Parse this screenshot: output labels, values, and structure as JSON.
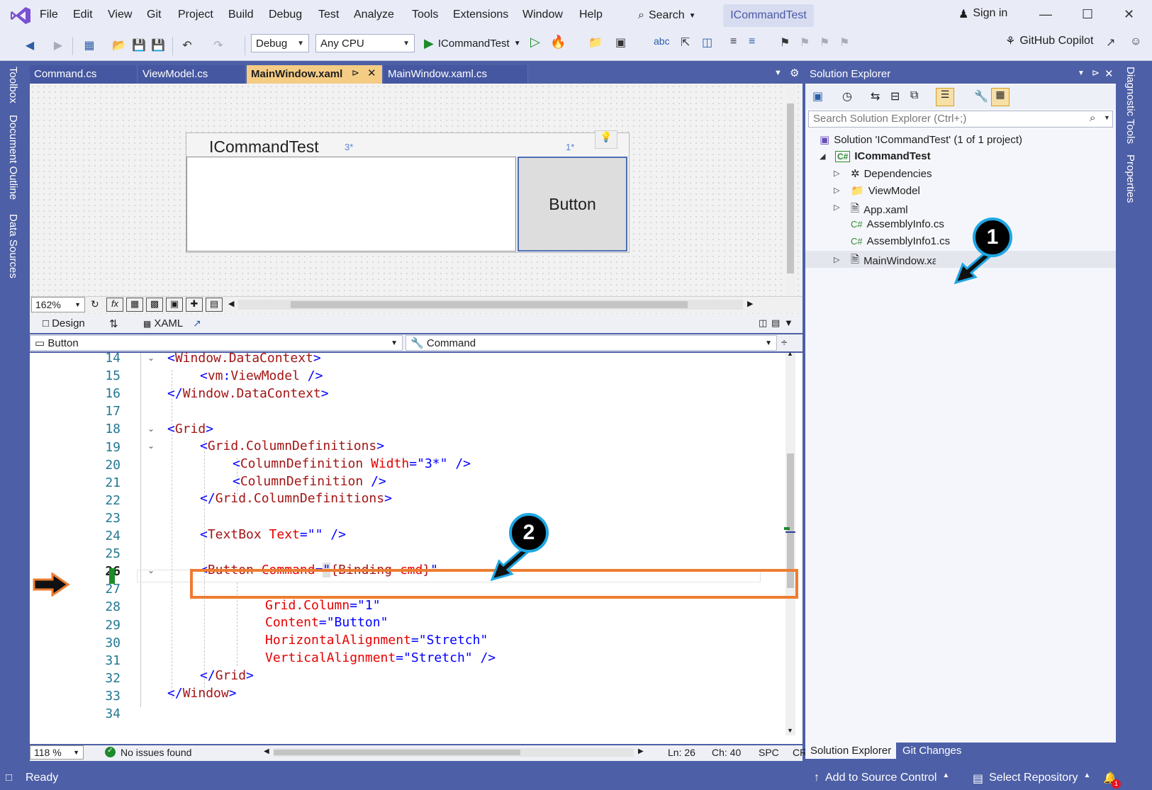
{
  "menubar": {
    "items": [
      "File",
      "Edit",
      "View",
      "Git",
      "Project",
      "Build",
      "Debug",
      "Test",
      "Analyze",
      "Tools",
      "Extensions",
      "Window",
      "Help"
    ],
    "search_label": "Search",
    "title": "ICommandTest",
    "sign_in": "Sign in"
  },
  "toolbar": {
    "config": "Debug",
    "platform": "Any CPU",
    "run_target": "ICommandTest",
    "copilot": "GitHub Copilot"
  },
  "left_rail": [
    "Toolbox",
    "Document Outline",
    "Data Sources"
  ],
  "right_rail": [
    "Diagnostic Tools",
    "Properties"
  ],
  "tabs": [
    {
      "label": "Command.cs"
    },
    {
      "label": "ViewModel.cs"
    },
    {
      "label": "MainWindow.xaml"
    },
    {
      "label": "MainWindow.xaml.cs"
    }
  ],
  "designer": {
    "window_title": "ICommandTest",
    "col1_marker": "3*",
    "col2_marker": "1*",
    "button_label": "Button",
    "zoom": "162%",
    "fx": "fx"
  },
  "split": {
    "design": "Design",
    "xaml": "XAML"
  },
  "nav": {
    "left": "Button",
    "right": "Command"
  },
  "code": {
    "line_numbers": [
      "14",
      "15",
      "16",
      "17",
      "18",
      "19",
      "20",
      "21",
      "22",
      "23",
      "24",
      "25",
      "26",
      "27",
      "28",
      "29",
      "30",
      "31",
      "32",
      "33",
      "34"
    ]
  },
  "editor_status": {
    "zoom": "118 %",
    "issues": "No issues found",
    "ln": "Ln: 26",
    "ch": "Ch: 40",
    "spc": "SPC",
    "crlf": "CRLF"
  },
  "solution_explorer": {
    "title": "Solution Explorer",
    "search_placeholder": "Search Solution Explorer (Ctrl+;)",
    "solution": "Solution 'ICommandTest' (1 of 1 project)",
    "project": "ICommandTest",
    "items": [
      "Dependencies",
      "ViewModel",
      "App.xaml",
      "AssemblyInfo.cs",
      "AssemblyInfo1.cs",
      "MainWindow.xaml"
    ],
    "bottom_tabs": [
      "Solution Explorer",
      "Git Changes"
    ]
  },
  "statusbar": {
    "ready": "Ready",
    "add_source": "Add to Source Control",
    "select_repo": "Select Repository",
    "notifications": "1"
  },
  "annotations": {
    "callout1": "1",
    "callout2": "2"
  },
  "colors": {
    "accent": "#4d5fa6",
    "active_tab": "#f5cc84",
    "highlight": "#ed7d31",
    "callout_ring": "#1ea7e3"
  }
}
